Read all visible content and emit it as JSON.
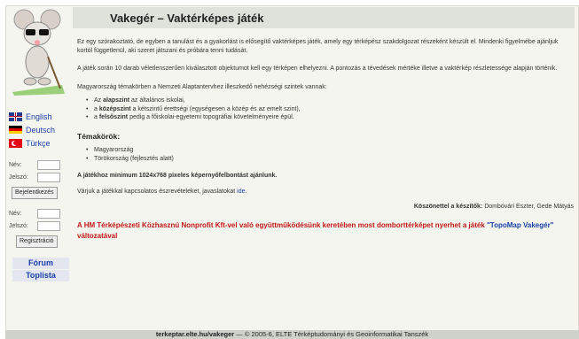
{
  "page": {
    "title": "Vakegér – Vaktérképes játék",
    "languages": [
      {
        "label": "English",
        "flag": "uk-flag-icon"
      },
      {
        "label": "Deutsch",
        "flag": "germany-flag-icon"
      },
      {
        "label": "Türkçe",
        "flag": "turkey-flag-icon"
      }
    ],
    "login": {
      "name_label": "Név:",
      "password_label": "Jelszó:",
      "login_button": "Bejelentkezés"
    },
    "register": {
      "name_label": "Név:",
      "password_label": "Jelszó:",
      "register_button": "Regisztráció"
    },
    "sidelinks": {
      "forum": "Fórum",
      "toplist": "Toplista"
    },
    "intro1": "Ez egy szórakoztató, de egyben a tanulást és a gyakorlást is elősegítő vaktérképes játék, amely egy térképész szakdolgozat részeként készült el. Mindenki figyelmébe ajánljuk kortól függetlenül, aki szeret játszani és próbára tenni tudását.",
    "intro2": "A játék során 10 darab véletlenszerűen kiválasztott objektumot kell egy térképen elhelyezni. A pontozás a tévedések mértéke illetve a vaktérkép részletessége alapján történik.",
    "intro3": "Magyarország témakörben a Nemzeti Alaptantervhez illeszkedő nehézségi szintek vannak:",
    "levels": [
      {
        "prefix": "Az ",
        "bold": "alapszint",
        "rest": " az általános iskolai,"
      },
      {
        "prefix": "a ",
        "bold": "középszint",
        "rest": " a kétszintű érettségi (egységesen a közép és az emelt szint),"
      },
      {
        "prefix": "a ",
        "bold": "felsőszint",
        "rest": " pedig a főiskolai-egyetemi topográfiai követelményeire épül."
      }
    ],
    "topics_heading": "Témakörök:",
    "topics": [
      "Magyarország",
      "Törökország (fejlesztés alatt)"
    ],
    "resolution_note": "A játékhoz minimum 1024x768 pixeles képernyőfelbontást ajánlunk.",
    "feedback_text": "Várjuk a játékkal kapcsolatos észrevételeket, javaslatokat ",
    "feedback_link": "ide",
    "feedback_dot": ".",
    "thanks_label": "Köszönettel a készítők:",
    "thanks_names": " Dombóvári Eszter, Gede Mátyás",
    "promo_part1": "A HM Térképészeti Közhasznú Nonprofit Kft-vel való együttműködésünk keretében most domborttérképet nyerhet a játék ",
    "promo_link": "\"TopoMap Vakegér\"",
    "promo_part2": " változatával",
    "footer": {
      "site": "terkeptar.elte.hu/vakeger",
      "rest": " — © 2005-6, ELTE Térképtudományi és Geoinformatikai Tanszék"
    }
  }
}
